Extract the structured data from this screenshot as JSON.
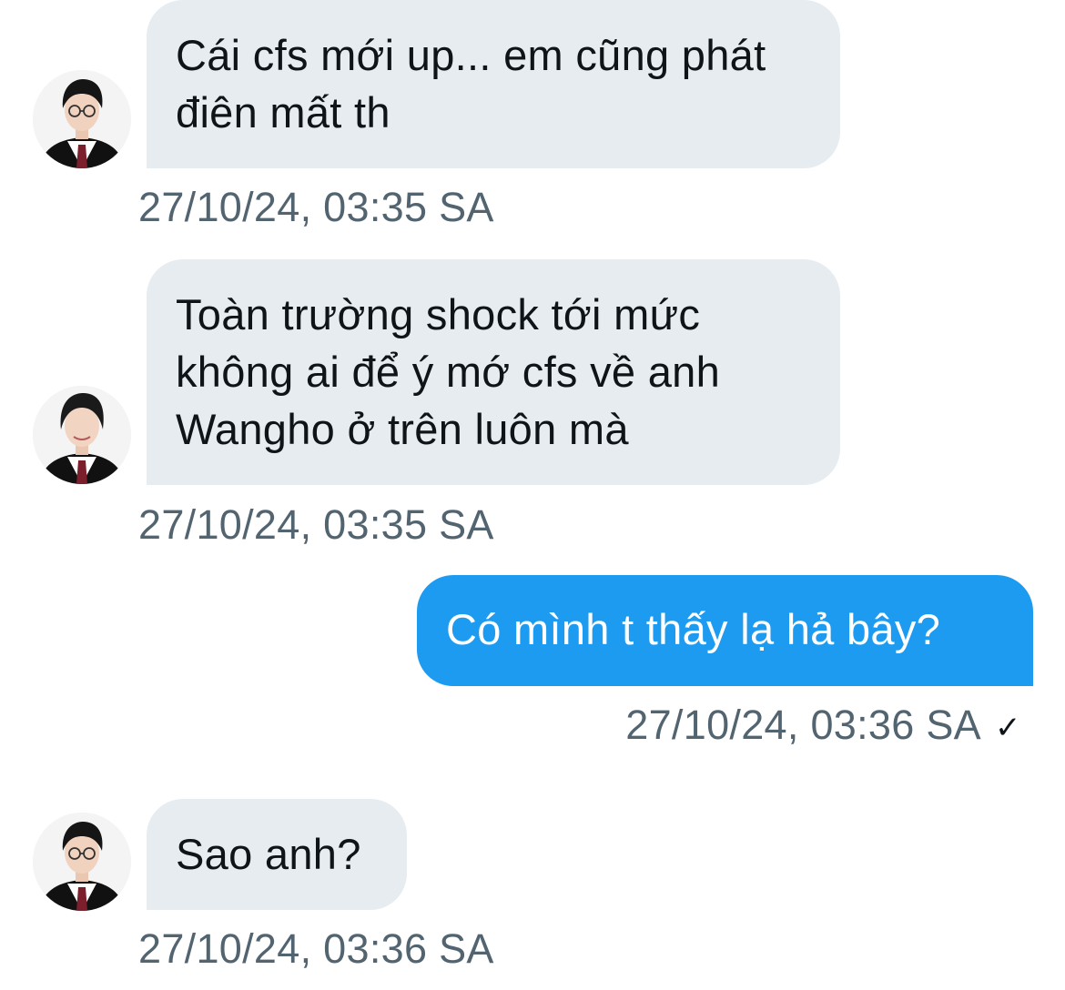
{
  "conversation": {
    "messages": [
      {
        "direction": "incoming",
        "text": "Cái cfs mới up... em cũng phát điên mất th",
        "timestamp": "27/10/24, 03:35 SA"
      },
      {
        "direction": "incoming",
        "text": "Toàn trường shock tới mức không ai để ý mớ cfs về anh Wangho ở trên luôn mà",
        "timestamp": "27/10/24, 03:35 SA"
      },
      {
        "direction": "outgoing",
        "text": "Có mình t thấy lạ hả bây?",
        "timestamp": "27/10/24, 03:36 SA",
        "read_receipt": "✓"
      },
      {
        "direction": "incoming",
        "text": "Sao anh?",
        "timestamp": "27/10/24, 03:36 SA"
      }
    ]
  },
  "colors": {
    "incoming_bubble": "#e7ecf0",
    "outgoing_bubble": "#1d9bf0",
    "timestamp": "#536471",
    "text_dark": "#0f1419"
  },
  "icons": {
    "avatar": "user-avatar-icon",
    "read_receipt": "checkmark-icon"
  }
}
